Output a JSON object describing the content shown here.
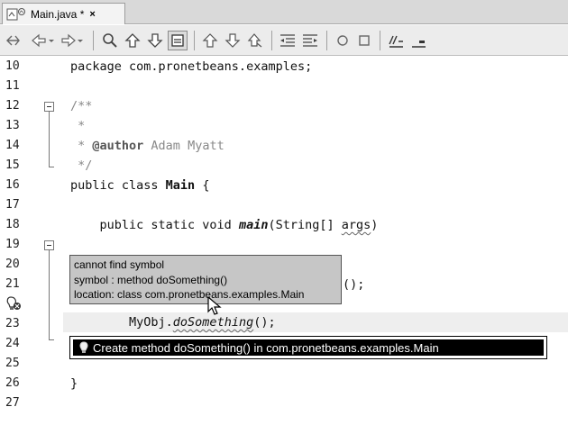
{
  "tab": {
    "title": "Main.java *",
    "close": "×"
  },
  "toolbar": {
    "icons": [
      "last-edit-icon",
      "back-icon",
      "forward-icon",
      "find-selection-icon",
      "find-previous-icon",
      "find-next-icon",
      "toggle-highlight-icon",
      "previous-bookmark-icon",
      "next-bookmark-icon",
      "toggle-bookmark-icon",
      "shift-left-icon",
      "shift-right-icon",
      "start-macro-icon",
      "stop-macro-icon",
      "comment-icon",
      "uncomment-icon"
    ]
  },
  "editor": {
    "line_numbers": [
      "10",
      "11",
      "12",
      "13",
      "14",
      "15",
      "16",
      "17",
      "18",
      "19",
      "20",
      "21",
      "",
      "23",
      "24",
      "25",
      "26",
      "27"
    ],
    "lines": {
      "l10": "package com.pronetbeans.examples;",
      "l12": "/**",
      "l13": " *",
      "l14_a": " * ",
      "l14_tag": "@author",
      "l14_b": " Adam Myatt",
      "l15": " */",
      "l16_a": "public class ",
      "l16_b": "Main",
      "l16_c": " {",
      "l18_a": "    public static void ",
      "l18_b": "main",
      "l18_c": "(String[] ",
      "l18_d": "args",
      "l18_e": ")",
      "l20_tail": "();",
      "l22_a": "        MyObj.",
      "l22_b": "doSomething",
      "l22_c": "();",
      "l25": "}"
    }
  },
  "tooltip": {
    "line1": "cannot find symbol",
    "line2": "symbol : method doSomething()",
    "line3": "location: class com.pronetbeans.examples.Main"
  },
  "hint": {
    "label": "Create method doSomething() in com.pronetbeans.examples.Main"
  }
}
